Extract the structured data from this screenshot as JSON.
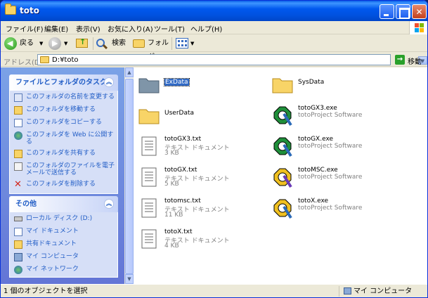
{
  "window": {
    "title": "toto"
  },
  "menu": [
    "ファイル(F)",
    "編集(E)",
    "表示(V)",
    "お気に入り(A)",
    "ツール(T)",
    "ヘルプ(H)"
  ],
  "toolbar": {
    "back": "戻る",
    "search": "検索",
    "folders": "フォルダ"
  },
  "address": {
    "label": "アドレス(D)",
    "value": "D:¥toto",
    "go": "移動"
  },
  "task_panel": {
    "title": "ファイルとフォルダのタスク",
    "items": [
      {
        "label": "このフォルダの名前を変更する",
        "icon": "rename-icon"
      },
      {
        "label": "このフォルダを移動する",
        "icon": "move-icon"
      },
      {
        "label": "このフォルダをコピーする",
        "icon": "copy-icon"
      },
      {
        "label": "このフォルダを Web に公開する",
        "icon": "web-publish-icon"
      },
      {
        "label": "このフォルダを共有する",
        "icon": "share-icon"
      },
      {
        "label": "このフォルダのファイルを電子メールで送信する",
        "icon": "email-icon"
      },
      {
        "label": "このフォルダを削除する",
        "icon": "delete-icon"
      }
    ]
  },
  "other_panel": {
    "title": "その他",
    "items": [
      {
        "label": "ローカル ディスク (D:)",
        "icon": "drive-icon"
      },
      {
        "label": "マイ ドキュメント",
        "icon": "my-documents-icon"
      },
      {
        "label": "共有ドキュメント",
        "icon": "shared-documents-icon"
      },
      {
        "label": "マイ コンピュータ",
        "icon": "my-computer-icon"
      },
      {
        "label": "マイ ネットワーク",
        "icon": "my-network-icon"
      }
    ]
  },
  "files": [
    {
      "name": "ExData",
      "type": "folder",
      "selected": true
    },
    {
      "name": "SysData",
      "type": "folder"
    },
    {
      "name": "UserData",
      "type": "folder"
    },
    {
      "name": "totoGX3.exe",
      "type": "app",
      "desc": "totoProject Software"
    },
    {
      "name": "totoGX3.txt",
      "type": "text",
      "desc": "テキスト ドキュメント",
      "size": "3 KB"
    },
    {
      "name": "totoGX.exe",
      "type": "app",
      "desc": "totoProject Software"
    },
    {
      "name": "totoGX.txt",
      "type": "text",
      "desc": "テキスト ドキュメント",
      "size": "5 KB"
    },
    {
      "name": "totoMSC.exe",
      "type": "app",
      "desc": "totoProject Software"
    },
    {
      "name": "totomsc.txt",
      "type": "text",
      "desc": "テキスト ドキュメント",
      "size": "11 KB"
    },
    {
      "name": "totoX.exe",
      "type": "app",
      "desc": "totoProject Software"
    },
    {
      "name": "totoX.txt",
      "type": "text",
      "desc": "テキスト ドキュメント",
      "size": "4 KB"
    }
  ],
  "status": {
    "left": "1 個のオブジェクトを選択",
    "right": "マイ コンピュータ"
  }
}
